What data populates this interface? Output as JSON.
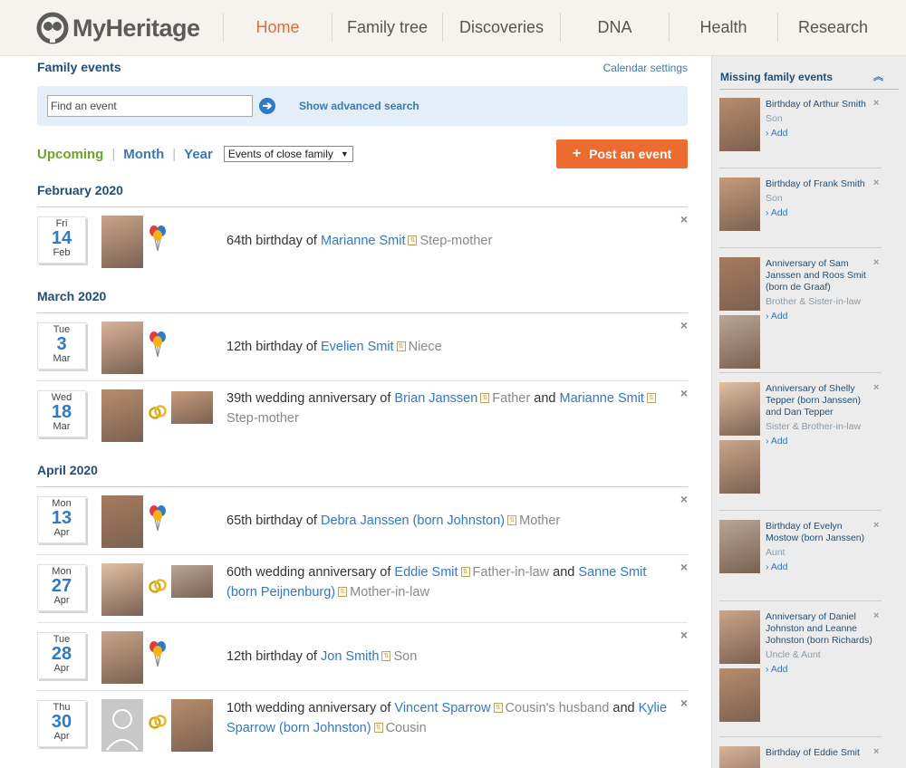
{
  "brand": {
    "name": "MyHeritage"
  },
  "nav": [
    "Home",
    "Family tree",
    "Discoveries",
    "DNA",
    "Health",
    "Research"
  ],
  "page": {
    "title": "Family events",
    "calendar_settings": "Calendar settings",
    "search_placeholder": "Find an event",
    "advanced_search": "Show advanced search",
    "filters": {
      "upcoming": "Upcoming",
      "month": "Month",
      "year": "Year",
      "select": "Events of close family"
    },
    "post_button": "Post an event"
  },
  "months": [
    {
      "title": "February 2020",
      "events": [
        {
          "dow": "Fri",
          "day": "14",
          "mon": "Feb",
          "type": "birthday",
          "pre": "64th birthday of ",
          "name1": "Marianne Smit",
          "rel1": "Step-mother",
          "name2": "",
          "rel2": ""
        }
      ]
    },
    {
      "title": "March 2020",
      "events": [
        {
          "dow": "Tue",
          "day": "3",
          "mon": "Mar",
          "type": "birthday",
          "pre": "12th birthday of ",
          "name1": "Evelien Smit",
          "rel1": "Niece",
          "name2": "",
          "rel2": ""
        },
        {
          "dow": "Wed",
          "day": "18",
          "mon": "Mar",
          "type": "wedding",
          "pre": "39th wedding anniversary of ",
          "name1": "Brian Janssen",
          "rel1": "Father",
          "name2": "Marianne Smit",
          "rel2": "Step-mother"
        }
      ]
    },
    {
      "title": "April 2020",
      "events": [
        {
          "dow": "Mon",
          "day": "13",
          "mon": "Apr",
          "type": "birthday",
          "pre": "65th birthday of ",
          "name1": "Debra Janssen (born Johnston)",
          "rel1": "Mother",
          "name2": "",
          "rel2": ""
        },
        {
          "dow": "Mon",
          "day": "27",
          "mon": "Apr",
          "type": "wedding",
          "pre": "60th wedding anniversary of ",
          "name1": "Eddie Smit",
          "rel1": "Father-in-law",
          "name2": "Sanne Smit (born Peijnenburg)",
          "rel2": "Mother-in-law"
        },
        {
          "dow": "Tue",
          "day": "28",
          "mon": "Apr",
          "type": "birthday",
          "pre": "12th birthday of ",
          "name1": "Jon Smith",
          "rel1": "Son",
          "name2": "",
          "rel2": ""
        },
        {
          "dow": "Thu",
          "day": "30",
          "mon": "Apr",
          "type": "wedding",
          "pre": "10th wedding anniversary of ",
          "name1": "Vincent Sparrow",
          "rel1": "Cousin's husband",
          "name2": "Kylie Sparrow (born Johnston)",
          "rel2": "Cousin"
        }
      ]
    }
  ],
  "conj": "and",
  "sidebar": {
    "title": "Missing family events",
    "add": "Add",
    "items": [
      {
        "title": "Birthday of Arthur Smith",
        "rel": "Son",
        "photos": 1
      },
      {
        "title": "Birthday of Frank Smith",
        "rel": "Son",
        "photos": 1
      },
      {
        "title": "Anniversary of Sam Janssen and Roos Smit (born de Graaf)",
        "rel": "Brother & Sister-in-law",
        "photos": 2
      },
      {
        "title": "Anniversary of Shelly Tepper (born Janssen) and Dan Tepper",
        "rel": "Sister & Brother-in-law",
        "photos": 2
      },
      {
        "title": "Birthday of Evelyn Mostow (born Janssen)",
        "rel": "Aunt",
        "photos": 1
      },
      {
        "title": "Anniversary of Daniel Johnston and Leanne Johnston (born Richards)",
        "rel": "Uncle & Aunt",
        "photos": 2
      },
      {
        "title": "Birthday of Eddie Smit",
        "rel": "",
        "photos": 1
      }
    ]
  },
  "colors": {
    "accent": "#ec6b2e",
    "link": "#2f79c5",
    "heading": "#1f4e79",
    "upcoming": "#6aa329"
  }
}
